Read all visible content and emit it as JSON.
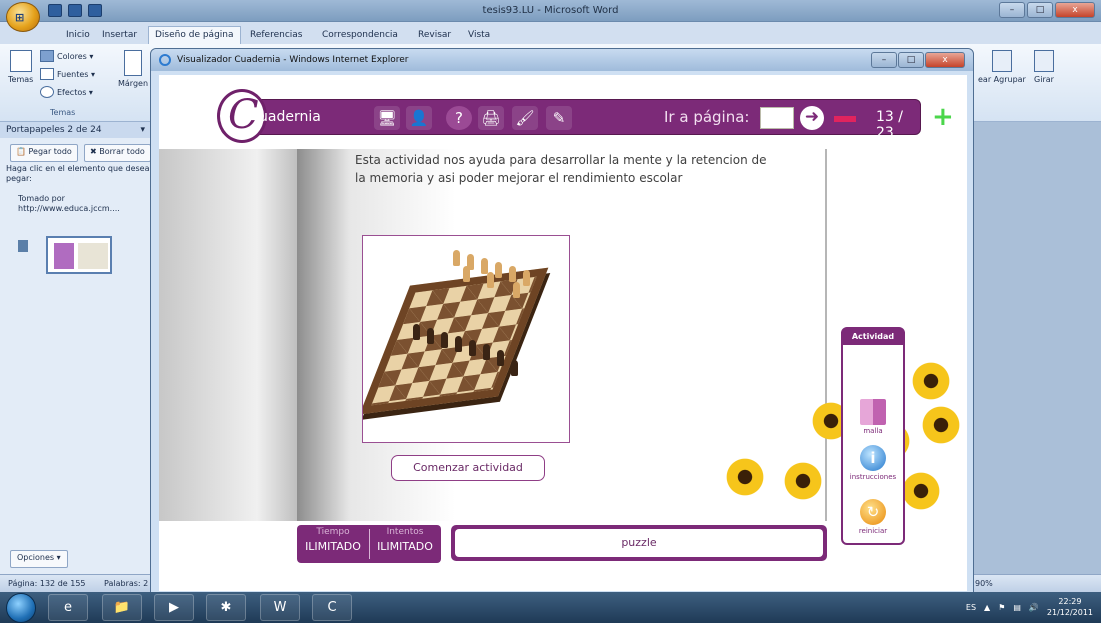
{
  "word": {
    "title": "tesis93.LU - Microsoft Word",
    "tabs": [
      "Inicio",
      "Insertar",
      "Diseño de página",
      "Referencias",
      "Correspondencia",
      "Revisar",
      "Vista"
    ],
    "active_tab": "Diseño de página",
    "ribbon": {
      "temas_label": "Temas",
      "colores": "Colores ▾",
      "fuentes": "Fuentes ▾",
      "efectos": "Efectos ▾",
      "margenes": "Márgen",
      "group_label": "Temas",
      "agrupar": "ear Agrupar",
      "girar": "Girar"
    },
    "clipboard": {
      "header": "Portapapeles 2 de 24",
      "paste_all": "Pegar todo",
      "clear_all": "Borrar todo",
      "hint": "Haga clic en el elemento que desea pegar:",
      "item1_line1": "Tomado por",
      "item1_line2": "http://www.educa.jccm....",
      "options": "Opciones ▾"
    },
    "status": {
      "page": "Página: 132 de 155",
      "words": "Palabras: 2",
      "zoom": "90%"
    }
  },
  "ie": {
    "title": "Visualizador Cuadernia - Windows Internet Explorer"
  },
  "cuadernia": {
    "logo_letter": "C",
    "logo_text": "uadernia",
    "goto_label": "Ir a página:",
    "page_count": "13 / 23",
    "description": "Esta actividad nos ayuda  para desarrollar la mente  y la retencion de la memoria y asi poder mejorar el rendimiento escolar",
    "start_button": "Comenzar actividad",
    "actividad": {
      "title": "Actividad",
      "items": [
        {
          "label": "malla",
          "icon": "grid-icon"
        },
        {
          "label": "instrucciones",
          "icon": "info-icon"
        },
        {
          "label": "reiniciar",
          "icon": "reload-icon"
        }
      ]
    },
    "counters": {
      "tiempo_label": "Tiempo",
      "tiempo_value": "ILIMITADO",
      "intentos_label": "Intentos",
      "intentos_value": "ILIMITADO"
    },
    "activity_name": "puzzle"
  },
  "taskbar": {
    "language": "ES",
    "time": "22:29",
    "date": "21/12/2011"
  },
  "colors": {
    "cuadernia_purple": "#7c2a78",
    "word_blue": "#c9d9ee",
    "taskbar": "#1f3a56"
  }
}
